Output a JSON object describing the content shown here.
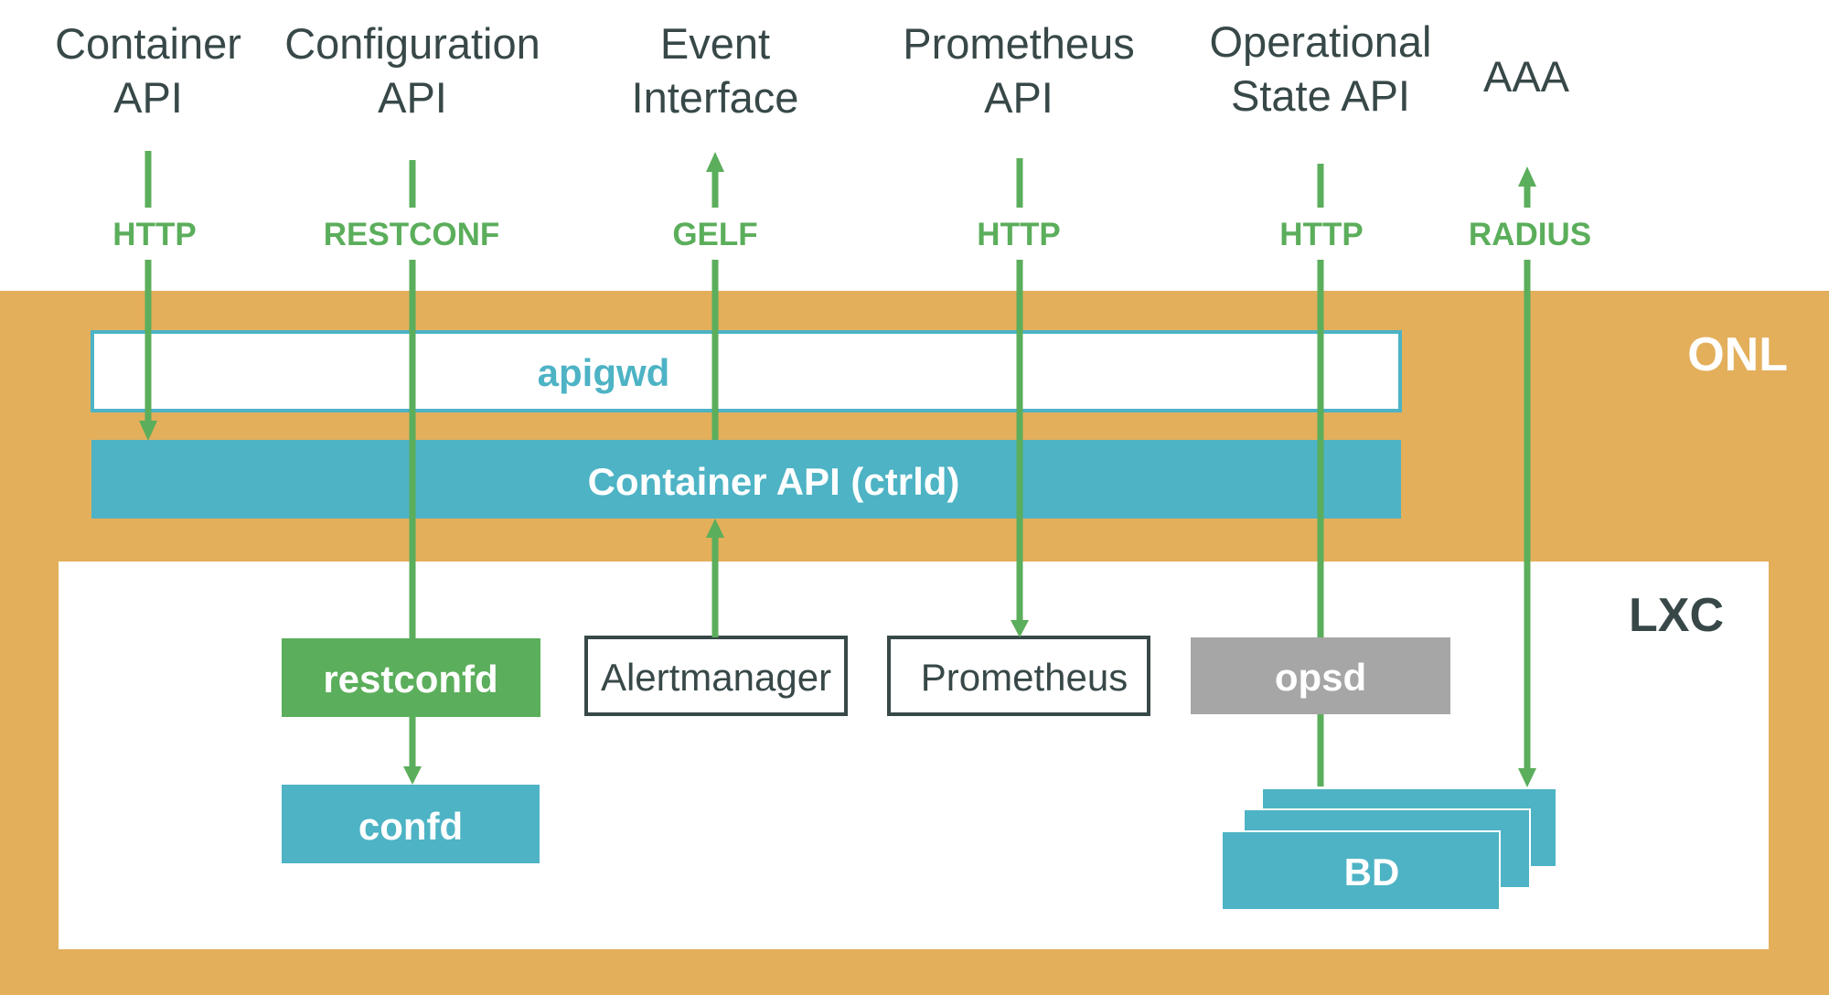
{
  "colors": {
    "onl_bg": "#e3af5b",
    "lxc_bg": "#ffffff",
    "teal": "#4db3c5",
    "green": "#5bae5b",
    "gray": "#a6a6a6",
    "dark_text": "#384848"
  },
  "top_labels": [
    {
      "line1": "Container",
      "line2": "API"
    },
    {
      "line1": "Configuration",
      "line2": "API"
    },
    {
      "line1": "Event",
      "line2": "Interface"
    },
    {
      "line1": "Prometheus",
      "line2": "API"
    },
    {
      "line1": "Operational",
      "line2": "State API"
    },
    {
      "line1": "AAA",
      "line2": ""
    }
  ],
  "protocols": [
    "HTTP",
    "RESTCONF",
    "GELF",
    "HTTP",
    "HTTP",
    "RADIUS"
  ],
  "regions": {
    "onl": "ONL",
    "lxc": "LXC"
  },
  "boxes": {
    "apigwd": "apigwd",
    "ctrld": "Container API (ctrld)",
    "restconfd": "restconfd",
    "alertmanager": "Alertmanager",
    "prometheus": "Prometheus",
    "opsd": "opsd",
    "confd": "confd",
    "bd": "BD"
  }
}
